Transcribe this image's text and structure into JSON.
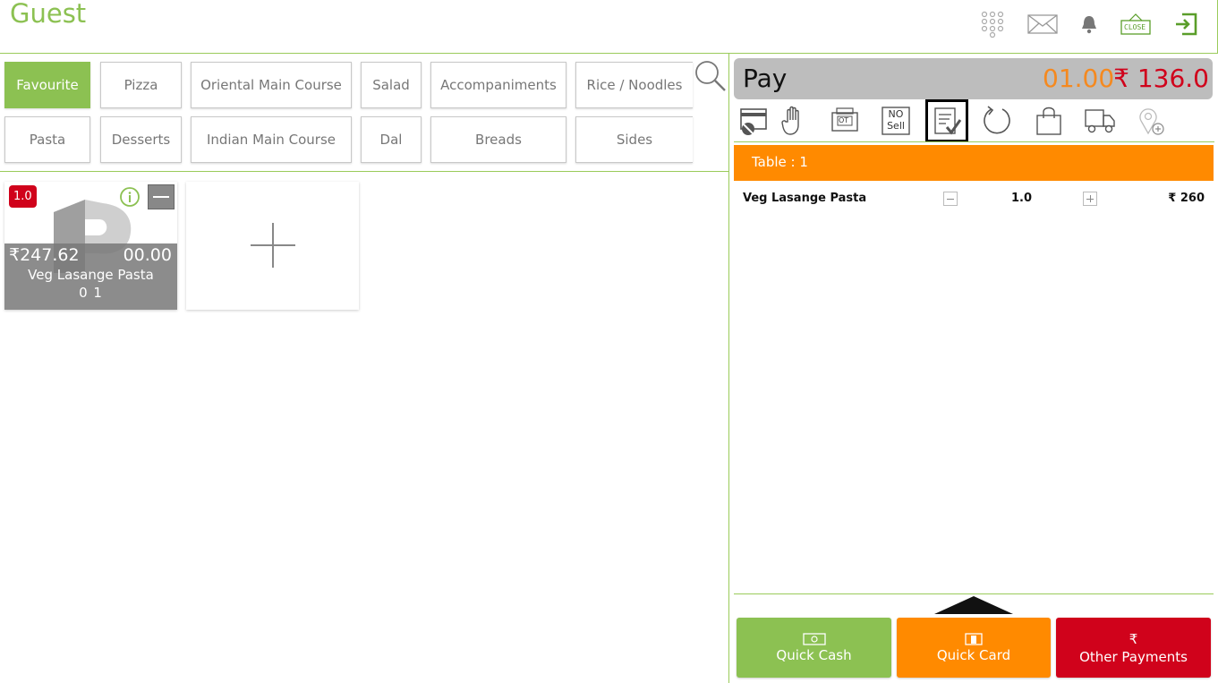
{
  "header": {
    "title": "Guest",
    "icons": [
      "keypad-icon",
      "mail-icon",
      "bell-icon",
      "close-sign-icon",
      "logout-icon"
    ],
    "close_sign_text": "CLOSE"
  },
  "categories": {
    "row1": [
      "Favourite",
      "Pizza",
      "Oriental Main Course",
      "Salad",
      "Accompaniments",
      "Rice / Noodles"
    ],
    "row2": [
      "Pasta",
      "Desserts",
      "Indian Main Course",
      "Dal",
      "Breads",
      "Sides"
    ],
    "active": "Favourite"
  },
  "items": [
    {
      "qty": "1.0",
      "price": "₹247.62",
      "discount": "00.00",
      "name": "Veg Lasange Pasta",
      "code": "0 1"
    }
  ],
  "order": {
    "pay_label": "Pay",
    "item_count": "01.00",
    "total": "₹ 136.0",
    "toolbar_no_sell": "NO Sell",
    "toolbar_ot": "OT",
    "table_label": "Table : 1",
    "lines": [
      {
        "name": "Veg Lasange Pasta",
        "qty": "1.0",
        "price": "₹ 260"
      }
    ]
  },
  "payments": {
    "quick_cash": "Quick Cash",
    "quick_card": "Quick Card",
    "other": "Other Payments",
    "rupee_symbol": "₹"
  },
  "colors": {
    "green": "#8cc152",
    "orange": "#ff8a00",
    "red": "#d0021b",
    "grey": "#bdbdbd"
  }
}
